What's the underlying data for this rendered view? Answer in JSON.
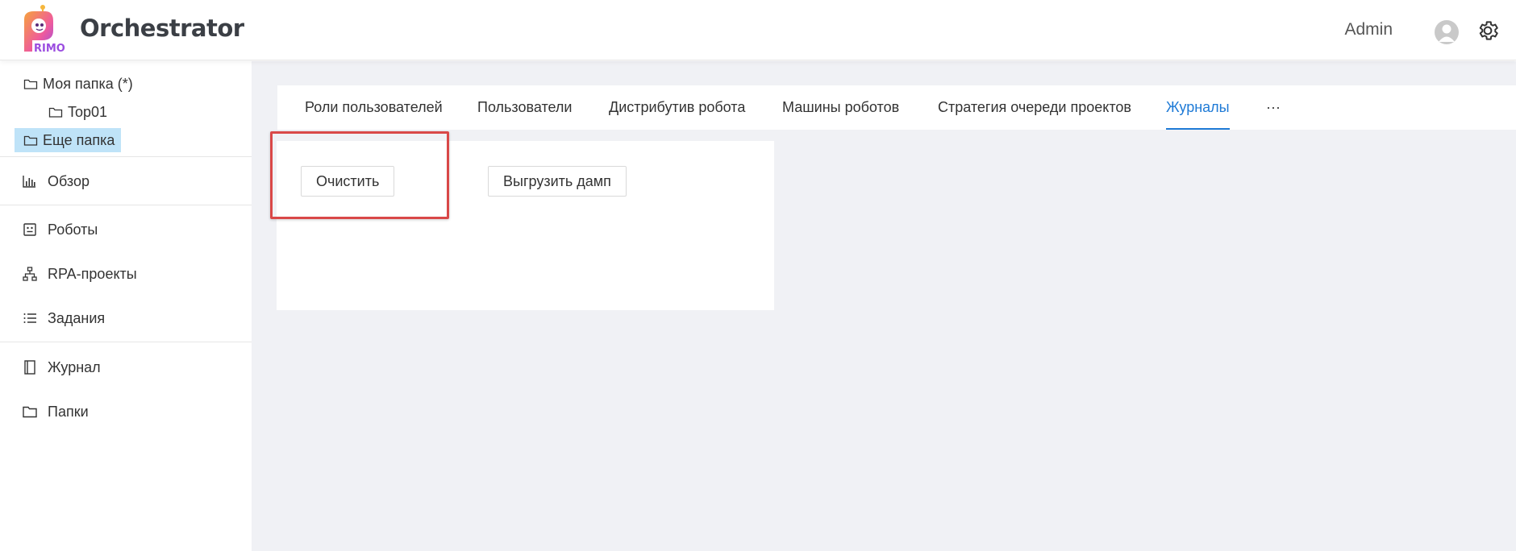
{
  "header": {
    "app_title": "Orchestrator",
    "logo_text": "PRIMO",
    "user_name": "Admin"
  },
  "sidebar": {
    "folders": [
      {
        "label": "Моя папка (*)",
        "icon": "folder-icon"
      },
      {
        "label": "Top01",
        "icon": "folder-icon"
      },
      {
        "label": "Еще папка",
        "icon": "folder-icon",
        "selected": true
      }
    ],
    "nav": [
      {
        "label": "Обзор",
        "icon": "bar-chart-icon"
      },
      {
        "label": "Роботы",
        "icon": "robot-icon"
      },
      {
        "label": "RPA-проекты",
        "icon": "hierarchy-icon"
      },
      {
        "label": "Задания",
        "icon": "list-icon"
      },
      {
        "label": "Журнал",
        "icon": "book-icon"
      },
      {
        "label": "Папки",
        "icon": "folder-icon"
      }
    ]
  },
  "tabs": [
    {
      "label": "Роли пользователей"
    },
    {
      "label": "Пользователи"
    },
    {
      "label": "Дистрибутив робота"
    },
    {
      "label": "Машины роботов"
    },
    {
      "label": "Стратегия очереди проектов"
    },
    {
      "label": "Журналы",
      "active": true
    },
    {
      "label": "···"
    }
  ],
  "panel": {
    "clear_button": "Очистить",
    "dump_button": "Выгрузить дамп"
  },
  "colors": {
    "accent": "#1e7ad6",
    "selected_bg": "#bfe3f8",
    "highlight": "#d94848",
    "main_bg": "#f0f1f5"
  }
}
